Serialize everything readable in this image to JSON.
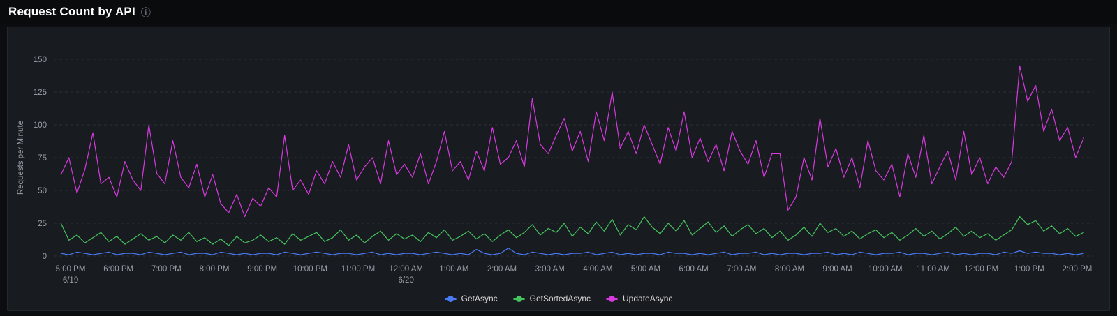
{
  "header": {
    "title": "Request Count by API",
    "info_icon": "ⓘ"
  },
  "theme": {
    "page_bg": "#0c0d10",
    "panel_bg": "#181b1f",
    "grid_color": "rgba(255,255,255,0.09)",
    "tick_text_color": "#9aa0ab",
    "legend_text_color": "#d8d9da"
  },
  "chart_data": {
    "type": "line",
    "title": "Request Count by API",
    "xlabel": "",
    "ylabel": "Requests per Minute",
    "ylim": [
      0,
      150
    ],
    "y_ticks": [
      0,
      25,
      50,
      75,
      100,
      125,
      150
    ],
    "grid": "horizontal-dashed",
    "legend_position": "bottom-center",
    "x_tick_labels": [
      "5:00 PM",
      "6:00 PM",
      "7:00 PM",
      "8:00 PM",
      "9:00 PM",
      "10:00 PM",
      "11:00 PM",
      "12:00 AM",
      "1:00 AM",
      "2:00 AM",
      "3:00 AM",
      "4:00 AM",
      "5:00 AM",
      "6:00 AM",
      "7:00 AM",
      "8:00 AM",
      "9:00 AM",
      "10:00 AM",
      "11:00 AM",
      "12:00 PM",
      "1:00 PM",
      "2:00 PM"
    ],
    "x_date_labels": [
      {
        "tick_index": 0,
        "label": "6/19"
      },
      {
        "tick_index": 7,
        "label": "6/20"
      }
    ],
    "x_range_hours": [
      -0.35,
      21.35
    ],
    "x_start_hours": -0.2,
    "x_step_hours": 0.16667,
    "series": [
      {
        "name": "GetAsync",
        "color": "#4a7bf7",
        "values": [
          2,
          1,
          3,
          2,
          1,
          2,
          3,
          1,
          2,
          2,
          1,
          3,
          2,
          1,
          2,
          3,
          1,
          2,
          2,
          1,
          3,
          2,
          1,
          2,
          1,
          2,
          2,
          1,
          3,
          2,
          1,
          2,
          3,
          2,
          1,
          2,
          2,
          1,
          2,
          3,
          1,
          2,
          1,
          2,
          2,
          1,
          2,
          3,
          2,
          1,
          2,
          1,
          5,
          2,
          1,
          2,
          6,
          2,
          1,
          3,
          2,
          1,
          2,
          1,
          2,
          2,
          3,
          1,
          2,
          3,
          1,
          2,
          1,
          2,
          2,
          1,
          3,
          2,
          2,
          1,
          2,
          1,
          2,
          3,
          1,
          2,
          2,
          3,
          1,
          2,
          1,
          2,
          2,
          1,
          2,
          2,
          3,
          1,
          2,
          1,
          3,
          2,
          1,
          2,
          2,
          3,
          1,
          2,
          2,
          1,
          2,
          3,
          1,
          2,
          1,
          2,
          2,
          1,
          3,
          2,
          4,
          2,
          3,
          2,
          2,
          1,
          2,
          1,
          2
        ]
      },
      {
        "name": "GetSortedAsync",
        "color": "#46c35f",
        "values": [
          25,
          12,
          16,
          10,
          14,
          18,
          11,
          15,
          9,
          13,
          17,
          12,
          15,
          10,
          16,
          12,
          18,
          11,
          14,
          9,
          13,
          8,
          15,
          10,
          12,
          16,
          11,
          14,
          9,
          17,
          12,
          15,
          18,
          11,
          14,
          20,
          12,
          16,
          10,
          15,
          19,
          12,
          17,
          13,
          16,
          11,
          18,
          14,
          20,
          12,
          15,
          19,
          13,
          17,
          11,
          16,
          20,
          14,
          18,
          24,
          16,
          21,
          18,
          25,
          15,
          22,
          17,
          26,
          19,
          28,
          16,
          24,
          20,
          30,
          22,
          17,
          25,
          19,
          27,
          16,
          21,
          26,
          18,
          23,
          15,
          20,
          24,
          17,
          21,
          14,
          19,
          12,
          16,
          22,
          15,
          25,
          18,
          21,
          15,
          19,
          13,
          17,
          20,
          14,
          18,
          12,
          16,
          21,
          15,
          19,
          13,
          17,
          22,
          15,
          19,
          14,
          17,
          12,
          16,
          20,
          30,
          24,
          27,
          19,
          23,
          17,
          21,
          15,
          18
        ]
      },
      {
        "name": "UpdateAsync",
        "color": "#d83ae0",
        "values": [
          62,
          75,
          48,
          66,
          94,
          55,
          60,
          45,
          72,
          58,
          50,
          100,
          63,
          55,
          88,
          60,
          52,
          70,
          45,
          62,
          40,
          33,
          47,
          30,
          44,
          38,
          52,
          45,
          92,
          50,
          58,
          47,
          65,
          55,
          72,
          60,
          85,
          58,
          68,
          75,
          55,
          88,
          62,
          70,
          60,
          78,
          55,
          72,
          95,
          65,
          72,
          58,
          80,
          65,
          98,
          70,
          75,
          88,
          68,
          120,
          85,
          78,
          92,
          105,
          80,
          95,
          72,
          110,
          88,
          125,
          82,
          95,
          78,
          100,
          85,
          70,
          98,
          80,
          110,
          75,
          90,
          72,
          85,
          65,
          95,
          80,
          70,
          88,
          60,
          78,
          78,
          35,
          45,
          75,
          58,
          105,
          68,
          82,
          60,
          75,
          52,
          88,
          65,
          58,
          70,
          45,
          78,
          60,
          92,
          55,
          68,
          80,
          58,
          95,
          62,
          75,
          55,
          68,
          60,
          72,
          145,
          118,
          130,
          95,
          112,
          88,
          98,
          75,
          90
        ]
      }
    ]
  }
}
